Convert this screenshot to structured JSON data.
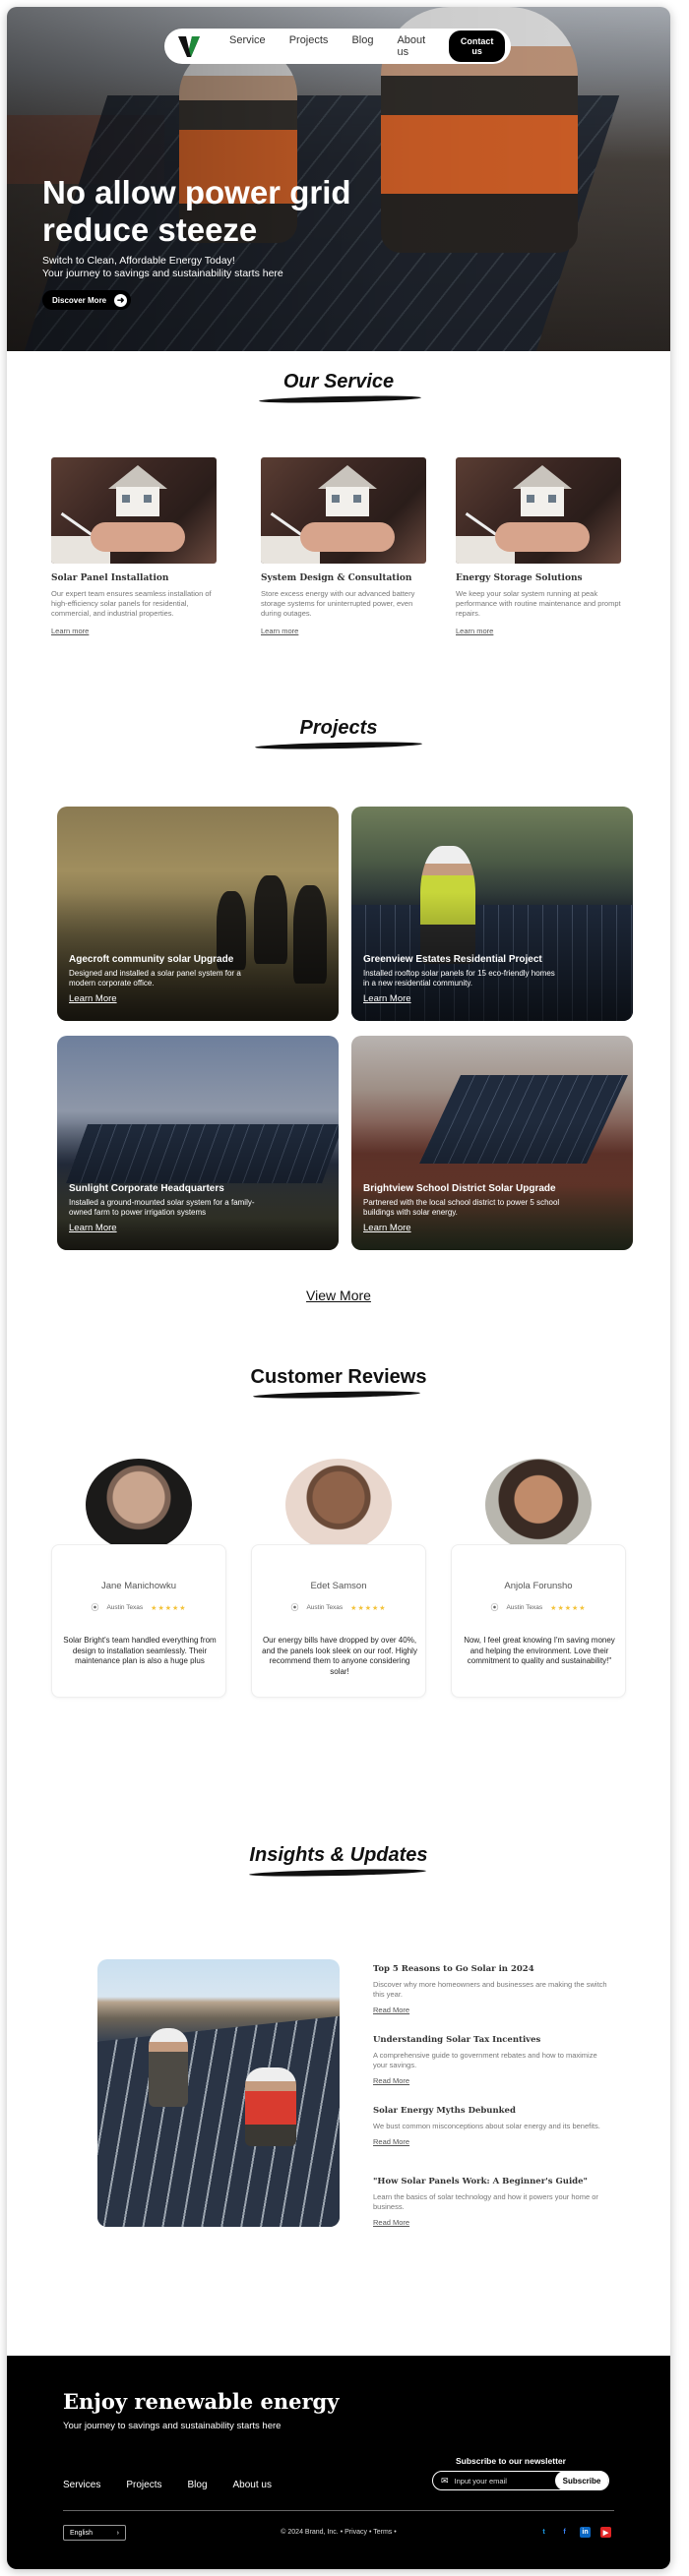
{
  "nav": {
    "links": [
      "Service",
      "Projects",
      "Blog",
      "About us"
    ],
    "contact_label": "Contact us"
  },
  "hero": {
    "title": "No allow power grid reduce steeze",
    "subtitle_line1": "Switch to Clean, Affordable Energy Today!",
    "subtitle_line2": "Your journey to savings and sustainability starts here",
    "cta_label": "Discover More"
  },
  "services": {
    "heading": "Our Service",
    "items": [
      {
        "title": "Solar Panel Installation",
        "text": "Our expert team ensures seamless installation of high-efficiency solar panels for residential, commercial, and industrial properties.",
        "link": "Learn more"
      },
      {
        "title": "System Design & Consultation",
        "text": "Store excess energy with our advanced battery storage systems for uninterrupted power, even during outages.",
        "link": "Learn more"
      },
      {
        "title": "Energy Storage Solutions",
        "text": "We keep your solar system running at peak performance with routine maintenance and prompt repairs.",
        "link": "Learn more"
      }
    ]
  },
  "projects": {
    "heading": "Projects",
    "items": [
      {
        "title": "Agecroft community solar Upgrade",
        "text": "Designed and installed a solar panel system for a modern corporate office.",
        "link": "Learn More"
      },
      {
        "title": "Greenview Estates Residential Project",
        "text": "Installed rooftop solar panels for 15 eco-friendly homes in a new residential community.",
        "link": "Learn More"
      },
      {
        "title": "Sunlight Corporate Headquarters",
        "text": "Installed a ground-mounted solar system for a family-owned farm to power irrigation systems",
        "link": "Learn More"
      },
      {
        "title": "Brightview School District Solar Upgrade",
        "text": "Partnered with the local school district to power 5 school buildings with solar energy.",
        "link": "Learn More"
      }
    ],
    "view_more": "View More"
  },
  "reviews": {
    "heading": "Customer Reviews",
    "items": [
      {
        "name": "Jane Manichowku",
        "location": "Austin Texas",
        "stars": "★★★★★",
        "text": "Solar Bright's team handled everything from design to installation seamlessly. Their maintenance plan is also a huge plus"
      },
      {
        "name": "Edet Samson",
        "location": "Austin Texas",
        "stars": "★★★★★",
        "text": "Our energy bills have dropped by over 40%, and the panels look sleek on our roof. Highly recommend them to anyone considering solar!"
      },
      {
        "name": "Anjola Forunsho",
        "location": "Austin Texas",
        "stars": "★★★★★",
        "text": "Now, I feel great knowing I'm saving money and helping the environment. Love their commitment to quality and sustainability!\""
      }
    ]
  },
  "insights": {
    "heading": "Insights & Updates",
    "articles": [
      {
        "title": "Top 5 Reasons to Go Solar in 2024",
        "text": "Discover why more homeowners and businesses are making the switch this year.",
        "link": "Read More"
      },
      {
        "title": "Understanding Solar Tax Incentives",
        "text": "A comprehensive guide to government rebates and how to maximize your savings.",
        "link": "Read More"
      },
      {
        "title": "Solar Energy Myths Debunked",
        "text": "We bust common misconceptions about solar energy and its benefits.",
        "link": "Read More"
      },
      {
        "title": "\"How Solar Panels Work: A Beginner's Guide\"",
        "text": "Learn the basics of solar technology and how it powers your home or business.",
        "link": "Read More"
      }
    ]
  },
  "footer": {
    "title": "Enjoy renewable energy",
    "subtitle": "Your journey to savings and sustainability starts here",
    "newsletter_label": "Subscribe to our newsletter",
    "email_placeholder": "Input your email",
    "subscribe_label": "Subscribe",
    "links": [
      "Services",
      "Projects",
      "Blog",
      "About us"
    ],
    "language": "English",
    "copyright": "© 2024 Brand, Inc. • Privacy • Terms •",
    "social_icons": [
      "twitter-icon",
      "facebook-icon",
      "linkedin-icon",
      "youtube-icon"
    ]
  },
  "colors": {
    "accent": "#000000",
    "logo_green": "#1f8a3a",
    "star": "#f3c33b"
  }
}
